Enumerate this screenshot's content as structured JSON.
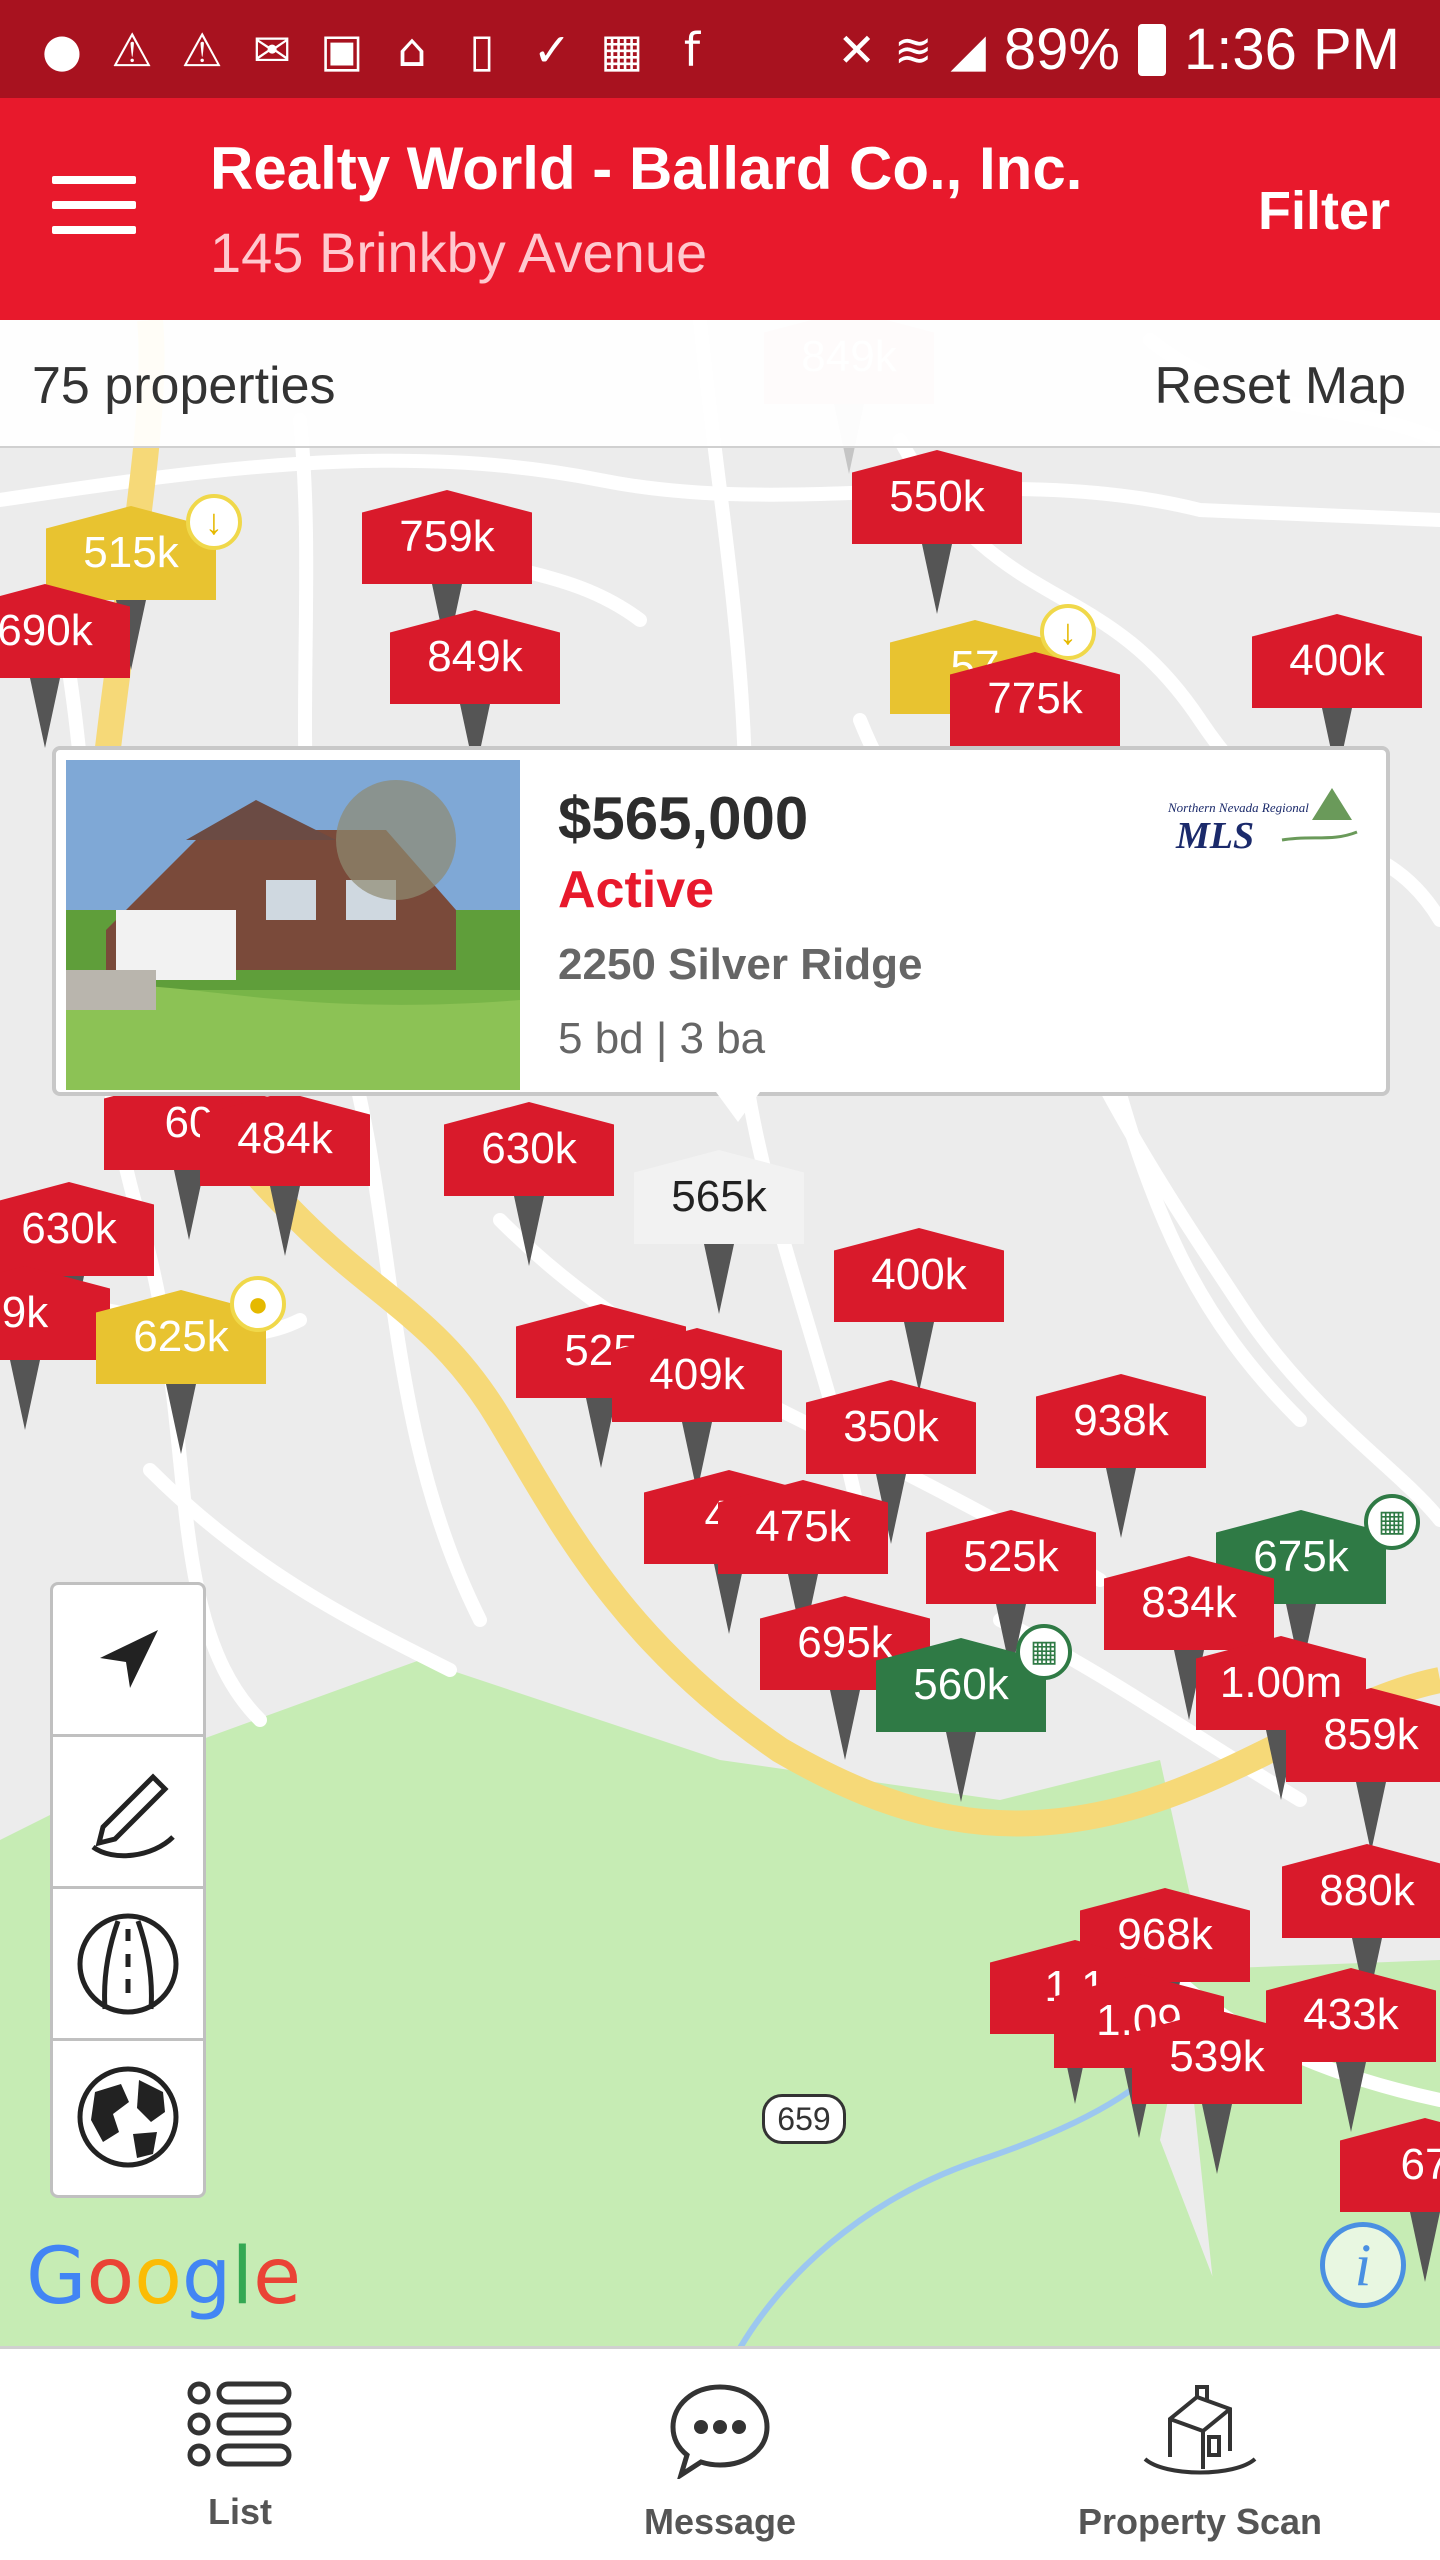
{
  "status_bar": {
    "battery": "89%",
    "time": "1:36 PM"
  },
  "app_bar": {
    "title": "Realty World - Ballard Co., Inc.",
    "subtitle": "145 Brinkby Avenue",
    "filter_label": "Filter"
  },
  "map_header": {
    "properties_count": "75 properties",
    "reset_label": "Reset Map"
  },
  "popup": {
    "price": "$565,000",
    "status": "Active",
    "address": "2250 Silver Ridge",
    "details": "5 bd | 3 ba",
    "mls_text": "MLS",
    "mls_subtext": "Northern Nevada Regional"
  },
  "route_sign": "659",
  "google_logo": [
    "G",
    "o",
    "o",
    "g",
    "l",
    "e"
  ],
  "pins": [
    {
      "label": "849k",
      "color": "red"
    },
    {
      "label": "550k",
      "color": "red"
    },
    {
      "label": "759k",
      "color": "red"
    },
    {
      "label": "515k",
      "color": "yellow"
    },
    {
      "label": "690k",
      "color": "red"
    },
    {
      "label": "849k",
      "color": "red"
    },
    {
      "label": "57",
      "color": "yellow"
    },
    {
      "label": "775k",
      "color": "red"
    },
    {
      "label": "400k",
      "color": "red"
    },
    {
      "label": "60",
      "color": "red"
    },
    {
      "label": "484k",
      "color": "red"
    },
    {
      "label": "630k",
      "color": "red"
    },
    {
      "label": "565k",
      "color": "white"
    },
    {
      "label": "630k",
      "color": "red"
    },
    {
      "label": "9k",
      "color": "red"
    },
    {
      "label": "625k",
      "color": "yellow"
    },
    {
      "label": "400k",
      "color": "red"
    },
    {
      "label": "525",
      "color": "red"
    },
    {
      "label": "409k",
      "color": "red"
    },
    {
      "label": "350k",
      "color": "red"
    },
    {
      "label": "938k",
      "color": "red"
    },
    {
      "label": "42",
      "color": "red"
    },
    {
      "label": "475k",
      "color": "red"
    },
    {
      "label": "525k",
      "color": "red"
    },
    {
      "label": "675k",
      "color": "green"
    },
    {
      "label": "695k",
      "color": "red"
    },
    {
      "label": "834k",
      "color": "red"
    },
    {
      "label": "560k",
      "color": "green"
    },
    {
      "label": "1.00m",
      "color": "red"
    },
    {
      "label": "859k",
      "color": "red"
    },
    {
      "label": "880k",
      "color": "red"
    },
    {
      "label": "968k",
      "color": "red"
    },
    {
      "label": "1.1",
      "color": "red"
    },
    {
      "label": "1.09",
      "color": "red"
    },
    {
      "label": "539k",
      "color": "red"
    },
    {
      "label": "433k",
      "color": "red"
    },
    {
      "label": "67",
      "color": "red"
    }
  ],
  "map_controls": [
    {
      "icon": "navigation-arrow-icon"
    },
    {
      "icon": "draw-pencil-icon"
    },
    {
      "icon": "road-icon"
    },
    {
      "icon": "globe-icon"
    }
  ],
  "bottom_nav": [
    {
      "label": "List",
      "icon": "list-icon"
    },
    {
      "label": "Message",
      "icon": "message-icon"
    },
    {
      "label": "Property Scan",
      "icon": "property-scan-icon"
    }
  ]
}
